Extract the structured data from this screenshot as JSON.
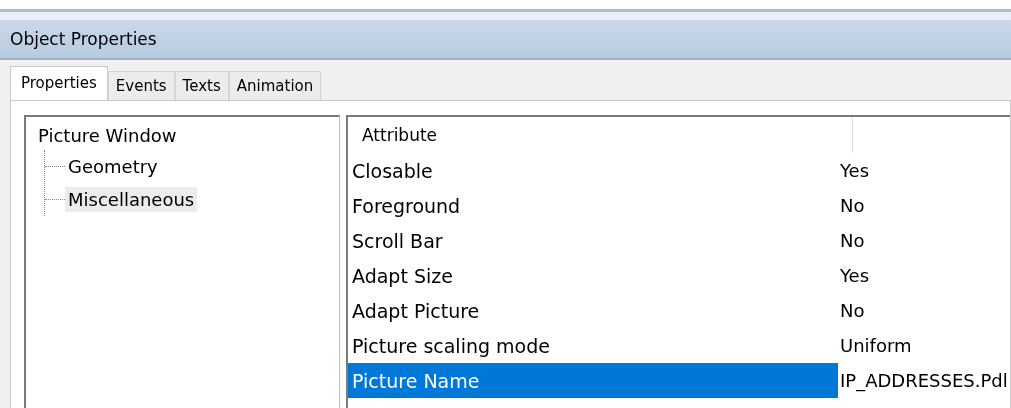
{
  "window": {
    "title": "Object Properties"
  },
  "tabs": [
    {
      "label": "Properties",
      "selected": true
    },
    {
      "label": "Events",
      "selected": false
    },
    {
      "label": "Texts",
      "selected": false
    },
    {
      "label": "Animation",
      "selected": false
    }
  ],
  "tree": [
    {
      "label": "Picture Window",
      "selected": false,
      "children": [
        {
          "label": "Geometry",
          "selected": false
        },
        {
          "label": "Miscellaneous",
          "selected": true
        }
      ]
    }
  ],
  "table": {
    "columns": [
      "Attribute"
    ],
    "rows": [
      {
        "attribute": "Closable",
        "value": "Yes",
        "selected": false
      },
      {
        "attribute": "Foreground",
        "value": "No",
        "selected": false
      },
      {
        "attribute": "Scroll Bar",
        "value": "No",
        "selected": false
      },
      {
        "attribute": "Adapt Size",
        "value": "Yes",
        "selected": false
      },
      {
        "attribute": "Adapt Picture",
        "value": "No",
        "selected": false
      },
      {
        "attribute": "Picture scaling mode",
        "value": "Uniform",
        "selected": false
      },
      {
        "attribute": "Picture Name",
        "value": "IP_ADDRESSES.Pdl",
        "selected": true
      }
    ]
  }
}
